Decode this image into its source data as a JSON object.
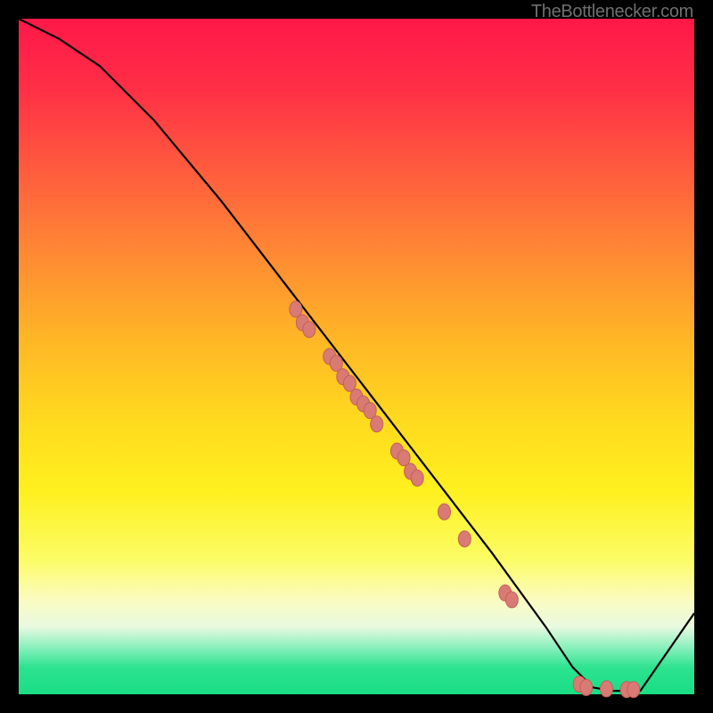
{
  "attribution": "TheBottlenecker.com",
  "chart_data": {
    "type": "line",
    "title": "",
    "xlabel": "",
    "ylabel": "",
    "xlim": [
      0,
      100
    ],
    "ylim": [
      0,
      100
    ],
    "series": [
      {
        "name": "bottleneck-curve",
        "x": [
          0,
          6,
          12,
          20,
          30,
          40,
          50,
          60,
          70,
          78,
          82,
          85,
          88,
          92,
          100
        ],
        "y": [
          100,
          97,
          93,
          85,
          73,
          60,
          47,
          34,
          21,
          10,
          4,
          1,
          0.5,
          0.5,
          12
        ]
      }
    ],
    "points": [
      {
        "name": "cluster-upper",
        "x": 41,
        "y": 57
      },
      {
        "name": "cluster-upper",
        "x": 42,
        "y": 55
      },
      {
        "name": "cluster-upper",
        "x": 43,
        "y": 54
      },
      {
        "name": "cluster-mid",
        "x": 46,
        "y": 50
      },
      {
        "name": "cluster-mid",
        "x": 47,
        "y": 49
      },
      {
        "name": "cluster-mid",
        "x": 48,
        "y": 47
      },
      {
        "name": "cluster-mid",
        "x": 49,
        "y": 46
      },
      {
        "name": "cluster-mid",
        "x": 50,
        "y": 44
      },
      {
        "name": "cluster-mid",
        "x": 51,
        "y": 43
      },
      {
        "name": "cluster-mid",
        "x": 52,
        "y": 42
      },
      {
        "name": "cluster-mid",
        "x": 53,
        "y": 40
      },
      {
        "name": "cluster-lower",
        "x": 56,
        "y": 36
      },
      {
        "name": "cluster-lower",
        "x": 57,
        "y": 35
      },
      {
        "name": "cluster-lower",
        "x": 58,
        "y": 33
      },
      {
        "name": "cluster-lower",
        "x": 59,
        "y": 32
      },
      {
        "name": "sparse",
        "x": 63,
        "y": 27
      },
      {
        "name": "sparse",
        "x": 66,
        "y": 23
      },
      {
        "name": "trough",
        "x": 72,
        "y": 15
      },
      {
        "name": "trough",
        "x": 73,
        "y": 14
      },
      {
        "name": "bottom",
        "x": 83,
        "y": 1.5
      },
      {
        "name": "bottom",
        "x": 84,
        "y": 1
      },
      {
        "name": "bottom",
        "x": 87,
        "y": 0.8
      },
      {
        "name": "bottom",
        "x": 90,
        "y": 0.7
      },
      {
        "name": "bottom",
        "x": 91,
        "y": 0.7
      }
    ],
    "colors": {
      "curve": "#000000",
      "points": "#d97b74",
      "gradient_top": "#ff1849",
      "gradient_mid": "#ffdb1e",
      "gradient_bottom": "#19dd84"
    }
  }
}
